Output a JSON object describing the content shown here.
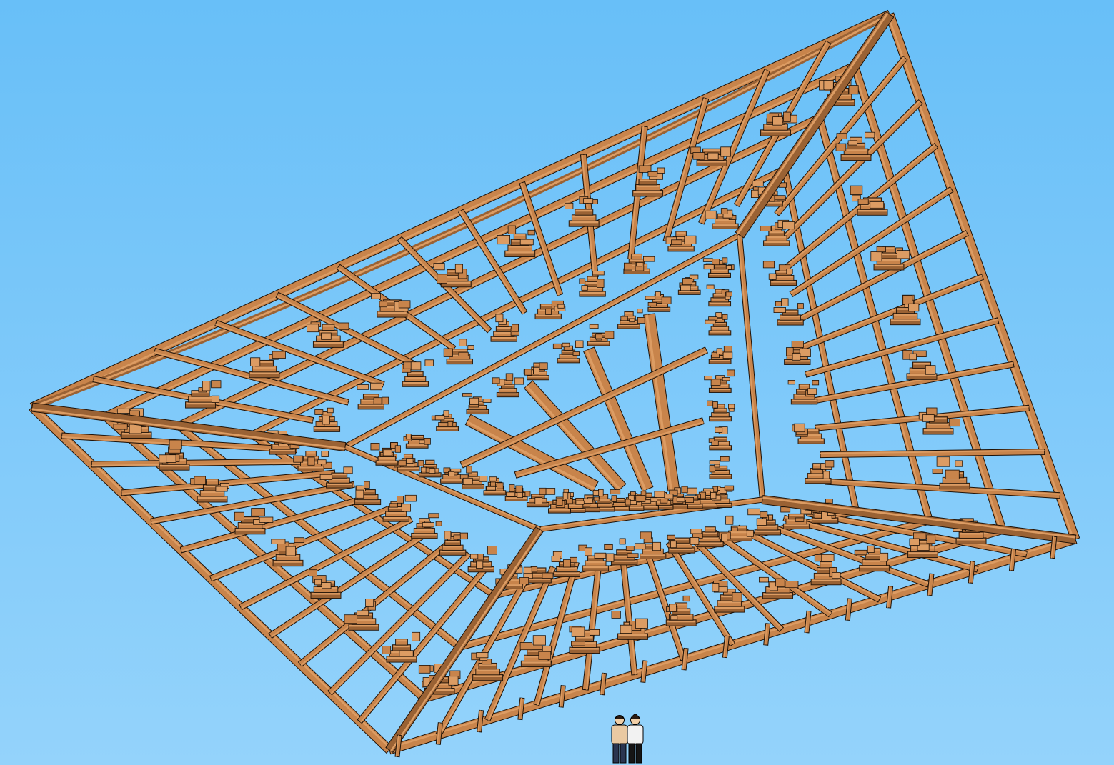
{
  "scene": {
    "sky_top_color": "#68bff8",
    "sky_bottom_color": "#94d3fb",
    "wood_color": "#c8844b",
    "wood_light_color": "#dc9c63",
    "wood_dark_color": "#9a6234",
    "edge_color": "#1e1208",
    "figures": [
      {
        "icon": "man-figure-icon",
        "shirt_color": "#e9c9a2",
        "pants_color": "#2a3550"
      },
      {
        "icon": "woman-figure-icon",
        "shirt_color": "#f2f2f2",
        "pants_color": "#151515"
      }
    ]
  }
}
